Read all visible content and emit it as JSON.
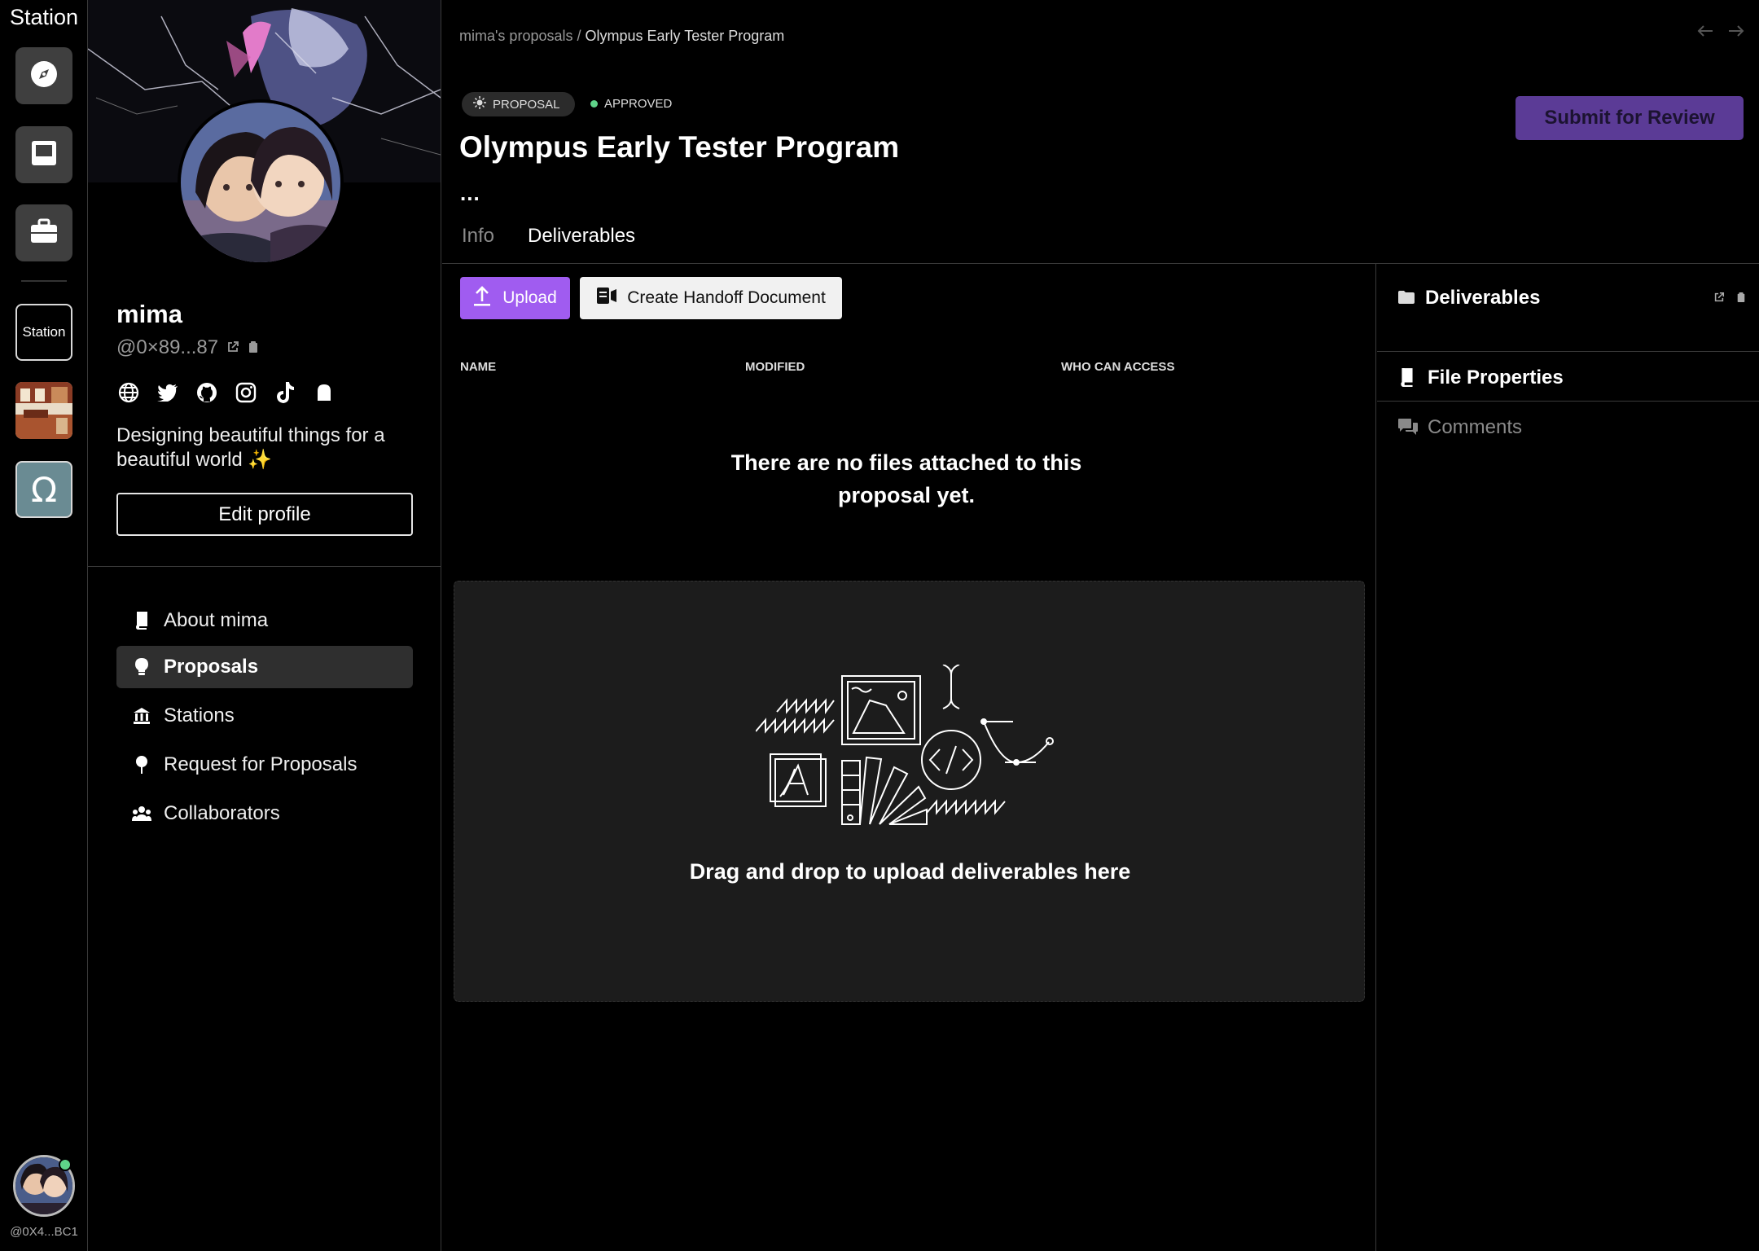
{
  "rail": {
    "title": "Station",
    "buttons": [
      {
        "icon": "compass-icon"
      },
      {
        "icon": "inbox-icon"
      },
      {
        "icon": "briefcase-icon"
      }
    ],
    "station_label": "Station",
    "omega_glyph": "Ω",
    "user_address": "@0X4...BC1"
  },
  "profile": {
    "name": "mima",
    "handle": "@0×89...87",
    "social_icons": [
      "globe-icon",
      "twitter-icon",
      "github-icon",
      "instagram-icon",
      "tiktok-icon",
      "ghost-icon"
    ],
    "bio": "Designing beautiful things for a beautiful world ✨",
    "edit_label": "Edit profile",
    "nav": [
      {
        "label": "About mima",
        "icon": "book-icon",
        "active": false
      },
      {
        "label": "Proposals",
        "icon": "lightbulb-icon",
        "active": true
      },
      {
        "label": "Stations",
        "icon": "bank-icon",
        "active": false
      },
      {
        "label": "Request for Proposals",
        "icon": "pin-icon",
        "active": false
      },
      {
        "label": "Collaborators",
        "icon": "people-icon",
        "active": false
      }
    ]
  },
  "main": {
    "breadcrumb": {
      "parent": "mima's proposals",
      "sep": " / ",
      "current": "Olympus Early Tester Program"
    },
    "badge_proposal": "PROPOSAL",
    "badge_status": "APPROVED",
    "title": "Olympus Early Tester Program",
    "ellipsis": "...",
    "submit_label": "Submit for Review",
    "tabs": {
      "info": "Info",
      "deliverables": "Deliverables"
    },
    "upload_label": "Upload",
    "handoff_label": "Create Handoff Document",
    "columns": {
      "name": "NAME",
      "modified": "MODIFIED",
      "who": "WHO CAN ACCESS"
    },
    "empty_message": "There are no files attached to this proposal yet.",
    "drop_message": "Drag and drop to upload deliverables here"
  },
  "side": {
    "deliverables": "Deliverables",
    "file_properties": "File Properties",
    "comments": "Comments"
  },
  "colors": {
    "accent_purple": "#a05cf0",
    "submit_purple": "#5b3b96",
    "status_green": "#5fd389",
    "panel_bg": "#1c1c1c"
  }
}
